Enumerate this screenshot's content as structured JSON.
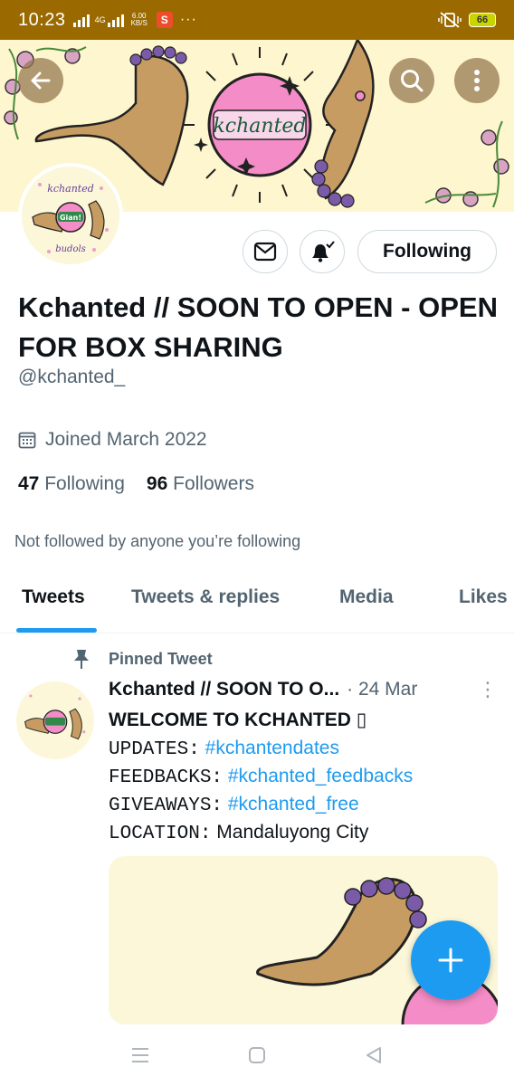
{
  "status_bar": {
    "time": "10:23",
    "network_type": "4G",
    "speed_value": "6.00",
    "speed_unit": "KB/S",
    "shopee_badge": "S",
    "more": "···",
    "battery": "66",
    "bg_color": "#9a6a00"
  },
  "banner": {
    "brand_text": "kchanted",
    "bg_color": "#fdf6cf",
    "back_icon": "arrow-left-icon",
    "search_icon": "search-icon",
    "more_icon": "kebab-vertical-icon"
  },
  "profile": {
    "avatar_text_top": "kchanted",
    "avatar_text_center": "Gian!",
    "avatar_text_bottom": "budols",
    "name": "Kchanted // SOON TO OPEN - OPEN FOR BOX SHARING",
    "handle": "@kchanted_",
    "joined": "Joined March 2022",
    "following_count": "47",
    "following_label": "Following",
    "followers_count": "96",
    "followers_label": "Followers",
    "not_followed": "Not followed by anyone you’re following",
    "message_icon": "mail-icon",
    "notification_icon": "bell-check-icon",
    "following_button": "Following"
  },
  "tabs": [
    {
      "label": "Tweets",
      "active": true
    },
    {
      "label": "Tweets & replies",
      "active": false
    },
    {
      "label": "Media",
      "active": false
    },
    {
      "label": "Likes",
      "active": false
    }
  ],
  "tweet": {
    "pinned_label": "Pinned Tweet",
    "author": "Kchanted // SOON TO O...",
    "date": "· 24 Mar",
    "more": "⋮",
    "title": "WELCOME TO KCHANTED ▯",
    "lines": [
      {
        "key": "UPDATES:",
        "value": "#kchantendates",
        "is_tag": true
      },
      {
        "key": "FEEDBACKS:",
        "value": "#kchanted_feedbacks",
        "is_tag": true
      },
      {
        "key": "GIVEAWAYS:",
        "value": "#kchanted_free",
        "is_tag": true
      },
      {
        "key": "LOCATION:",
        "value": "Mandaluyong City",
        "is_tag": false
      }
    ]
  },
  "fab": {
    "icon": "plus-icon",
    "color": "#1d9bf0"
  },
  "nav_bar": {
    "menu_icon": "recents-icon",
    "home_icon": "home-square-icon",
    "back_icon": "back-triangle-icon"
  },
  "colors": {
    "accent": "#1d9bf0",
    "secondary_text": "#536471",
    "primary_text": "#0f1419"
  }
}
